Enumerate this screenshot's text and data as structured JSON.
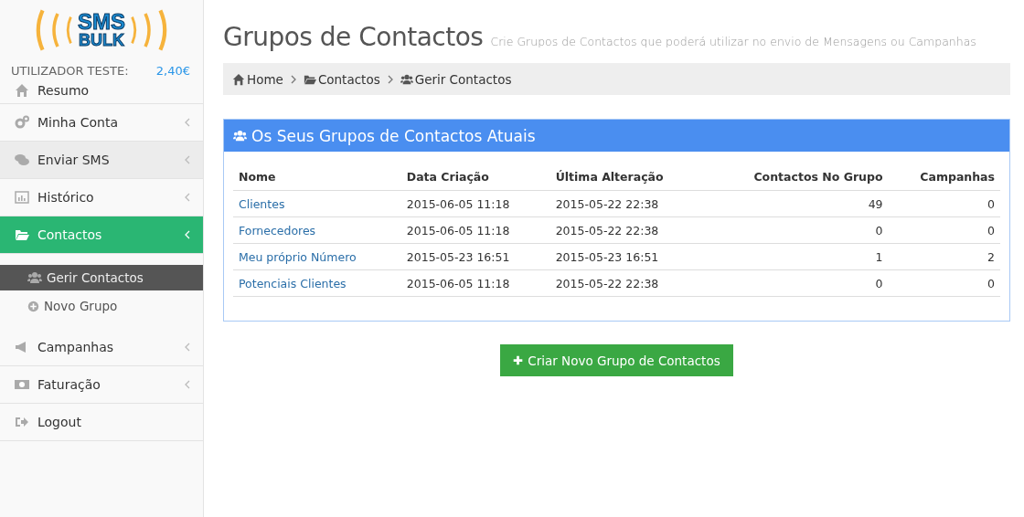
{
  "logo": {
    "line_1": "SMS",
    "line_2": "BULK"
  },
  "user": {
    "label": "UTILIZADOR TESTE:",
    "balance": "2,40€"
  },
  "sidebar": {
    "items": [
      {
        "label": "Resumo",
        "has_caret": false,
        "selected": false,
        "hovered": false
      },
      {
        "label": "Minha Conta",
        "has_caret": true,
        "selected": false,
        "hovered": false
      },
      {
        "label": "Enviar SMS",
        "has_caret": true,
        "selected": false,
        "hovered": true
      },
      {
        "label": "Histórico",
        "has_caret": true,
        "selected": false,
        "hovered": false
      },
      {
        "label": "Contactos",
        "has_caret": true,
        "selected": true,
        "hovered": false,
        "children": [
          {
            "label": "Gerir Contactos",
            "selected": true
          },
          {
            "label": "Novo Grupo",
            "selected": false
          }
        ]
      },
      {
        "label": "Campanhas",
        "has_caret": true,
        "selected": false,
        "hovered": false
      },
      {
        "label": "Faturação",
        "has_caret": true,
        "selected": false,
        "hovered": false
      },
      {
        "label": "Logout",
        "has_caret": false,
        "selected": false,
        "hovered": false
      }
    ]
  },
  "page": {
    "title": "Grupos de Contactos",
    "subtitle": "Crie Grupos de Contactos que poderá utilizar no envio de Mensagens ou Campanhas"
  },
  "breadcrumb": [
    "Home",
    "Contactos",
    "Gerir Contactos"
  ],
  "panel": {
    "title": "Os Seus Grupos de Contactos Atuais",
    "table": {
      "columns": [
        "Nome",
        "Data Criação",
        "Última Alteração",
        "Contactos No Grupo",
        "Campanhas"
      ],
      "rows": [
        [
          "Clientes",
          "2015-06-05 11:18",
          "2015-05-22 22:38",
          "49",
          "0"
        ],
        [
          "Fornecedores",
          "2015-06-05 11:18",
          "2015-05-22 22:38",
          "0",
          "0"
        ],
        [
          "Meu próprio Número",
          "2015-05-23 16:51",
          "2015-05-23 16:51",
          "1",
          "2"
        ],
        [
          "Potenciais Clientes",
          "2015-06-05 11:18",
          "2015-05-22 22:38",
          "0",
          "0"
        ]
      ]
    }
  },
  "create_button": "Criar Novo Grupo de Contactos"
}
